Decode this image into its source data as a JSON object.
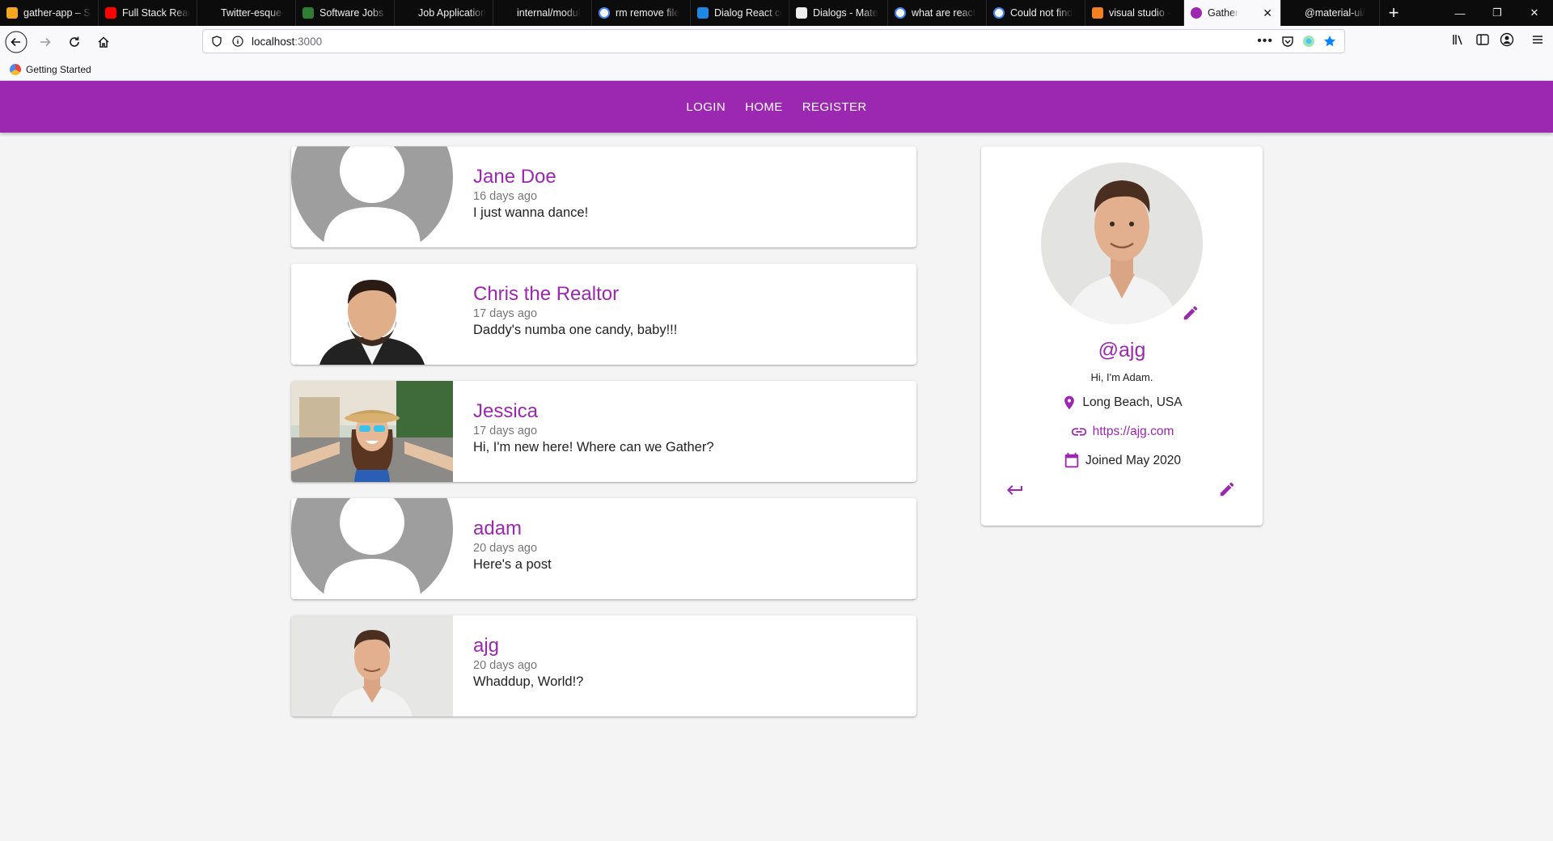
{
  "browser": {
    "tabs": [
      {
        "title": "gather-app – St",
        "icon": "firebase-icon",
        "color": "#f5a623"
      },
      {
        "title": "Full Stack Reac",
        "icon": "youtube-icon",
        "color": "#ff0000"
      },
      {
        "title": "Twitter-esque-",
        "icon": "blank-page-icon",
        "color": "#0c0c0d"
      },
      {
        "title": "Software Jobs i",
        "icon": "document-icon",
        "color": "#2e7d32"
      },
      {
        "title": "Job Application",
        "icon": "blank-page-icon",
        "color": "#0c0c0d"
      },
      {
        "title": "internal/modul",
        "icon": "blank-page-icon",
        "color": "#0c0c0d"
      },
      {
        "title": "rm remove file",
        "icon": "google-icon",
        "color": "#ffffff"
      },
      {
        "title": "Dialog React co",
        "icon": "material-ui-icon",
        "color": "#1e88e5"
      },
      {
        "title": "Dialogs - Mate",
        "icon": "material-doc-icon",
        "color": "#eeeeee"
      },
      {
        "title": "what are react",
        "icon": "google-icon",
        "color": "#ffffff"
      },
      {
        "title": "Could not find",
        "icon": "google-icon",
        "color": "#ffffff"
      },
      {
        "title": "visual studio - ",
        "icon": "stackoverflow-icon",
        "color": "#f48024"
      },
      {
        "title": "Gather",
        "icon": "gather-icon",
        "color": "#9c27b0",
        "active": true
      },
      {
        "title": "@material-ui/",
        "icon": "blank-page-icon",
        "color": "#0c0c0d"
      }
    ],
    "url_host": "localhost",
    "url_port": ":3000",
    "bookmark": "Getting Started"
  },
  "app": {
    "accent": "#9c27b0",
    "nav": [
      "LOGIN",
      "HOME",
      "REGISTER"
    ]
  },
  "posts": [
    {
      "handle": "Jane Doe",
      "date": "16 days ago",
      "body": "I just wanna dance!",
      "image": "default-avatar"
    },
    {
      "handle": "Chris the Realtor",
      "date": "17 days ago",
      "body": "Daddy's numba one candy, baby!!!",
      "image": "photo-man-suit"
    },
    {
      "handle": "Jessica",
      "date": "17 days ago",
      "body": "Hi, I'm new here! Where can we Gather?",
      "image": "photo-woman-selfie"
    },
    {
      "handle": "adam",
      "date": "20 days ago",
      "body": "Here's a post",
      "image": "default-avatar"
    },
    {
      "handle": "ajg",
      "date": "20 days ago",
      "body": "Whaddup, World!?",
      "image": "photo-man-tshirt"
    }
  ],
  "profile": {
    "handle": "@ajg",
    "bio": "Hi, I'm Adam.",
    "location": "Long Beach, USA",
    "website": "https://ajg.com",
    "joined": "Joined May 2020"
  }
}
